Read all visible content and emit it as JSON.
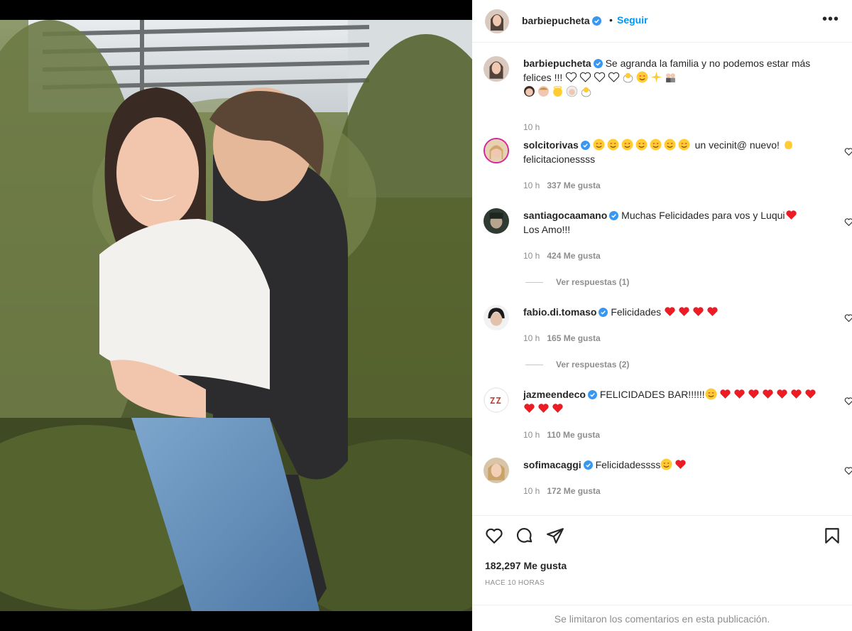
{
  "post": {
    "author": "barbiepucheta",
    "follow_label": "Seguir",
    "separator": "•",
    "more_label": "•••",
    "caption_text": "Se agranda la familia y no podemos estar más felices !!!",
    "caption_time": "10 h"
  },
  "comments": [
    {
      "username": "solcitorivas",
      "text": "un vecinit@ nuevo!",
      "text2": "felicitacionessss",
      "time": "10 h",
      "likes": "337 Me gusta"
    },
    {
      "username": "santiagocaamano",
      "text": "Muchas Felicidades para vos y Luqui",
      "text2": "Los Amo!!!",
      "time": "10 h",
      "likes": "424 Me gusta",
      "replies": "Ver respuestas (1)"
    },
    {
      "username": "fabio.di.tomaso",
      "text": "Felicidades",
      "time": "10 h",
      "likes": "165 Me gusta",
      "replies": "Ver respuestas (2)"
    },
    {
      "username": "jazmeendeco",
      "text": "FELICIDADES BAR!!!!!!",
      "time": "10 h",
      "likes": "110 Me gusta"
    },
    {
      "username": "sofimacaggi",
      "text": "Felicidadessss",
      "time": "10 h",
      "likes": "172 Me gusta"
    }
  ],
  "footer": {
    "likes": "182,297 Me gusta",
    "posted": "HACE 10 HORAS",
    "comments_limited": "Se limitaron los comentarios en esta publicación."
  },
  "icons": {
    "verified_color": "#3897f0",
    "link_color": "#0095f6",
    "heart_emoji_color": "#ed1c24"
  }
}
